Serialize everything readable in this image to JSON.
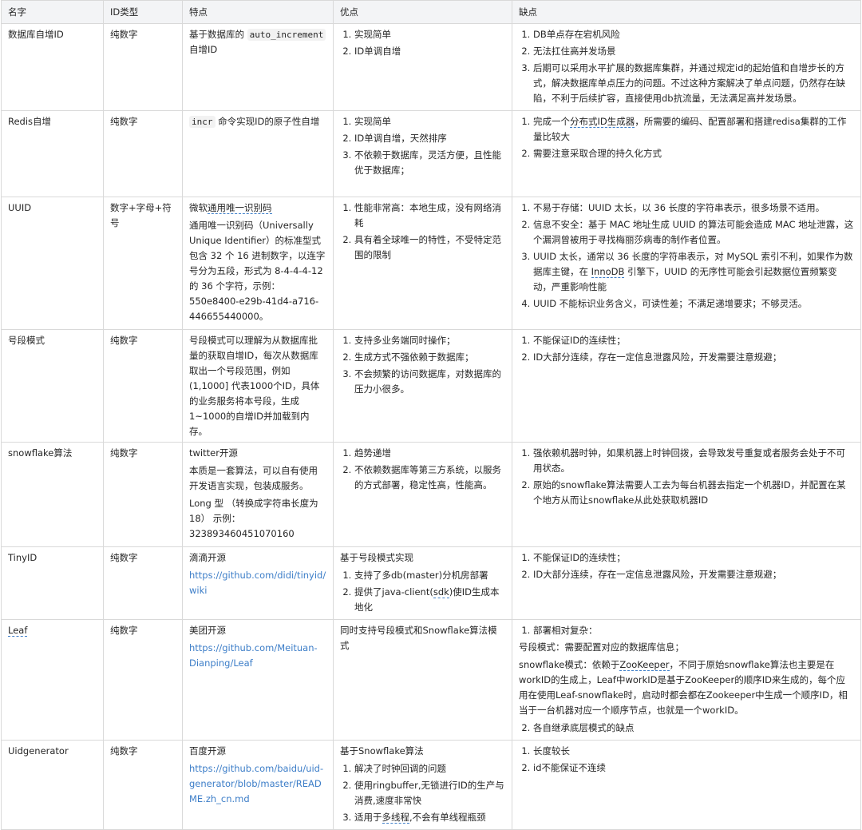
{
  "headers": [
    "名字",
    "ID类型",
    "特点",
    "优点",
    "缺点"
  ],
  "rows": [
    {
      "name": "数据库自增ID",
      "type": "纯数字",
      "features": {
        "prefix": "基于数据库的 ",
        "code": "auto_increment",
        "suffix": " 自增ID"
      },
      "pros": [
        "实现简单",
        "ID单调自增"
      ],
      "cons": [
        "DB单点存在宕机风险",
        "无法扛住高并发场景",
        "后期可以采用水平扩展的数据库集群，并通过规定id的起始值和自增步长的方式，解决数据库单点压力的问题。不过这种方案解决了单点问题，仍然存在缺陷，不利于后续扩容，直接使用db抗流量，无法满足高并发场景。"
      ]
    },
    {
      "name": "Redis自增",
      "type": "纯数字",
      "features": {
        "code": "incr",
        "suffix": " 命令实现ID的原子性自增"
      },
      "pros": [
        "实现简单",
        "ID单调自增，天然排序",
        "不依赖于数据库，灵活方便，且性能优于数据库；"
      ],
      "cons_first": {
        "pre": "完成一个",
        "link": "分布式ID生成器",
        "post": "，所需要的编码、配置部署和搭建redisa集群的工作量比较大"
      },
      "cons_rest": [
        "需要注意采取合理的持久化方式"
      ]
    },
    {
      "name": "UUID",
      "type": "数字+字母+符号",
      "features": {
        "pre": "微软",
        "link": "通用唯一识别码",
        "detail": "通用唯一识别码（Universally Unique Identifier）的标准型式包含 32 个 16 进制数字，以连字号分为五段，形式为 8-4-4-4-12 的 36 个字符，示例：550e8400-e29b-41d4-a716-446655440000。"
      },
      "pros": [
        "性能非常高：本地生成，没有网络消耗",
        "具有着全球唯一的特性，不受特定范围的限制"
      ],
      "cons": [
        "不易于存储：UUID 太长，以 36 长度的字符串表示，很多场景不适用。",
        "信息不安全：基于 MAC 地址生成 UUID 的算法可能会造成 MAC 地址泄露，这个漏洞曾被用于寻找梅丽莎病毒的制作者位置。"
      ],
      "cons_third": {
        "pre": "UUID 太长，通常以 36 长度的字符串表示，对 MySQL 索引不利，如果作为数据库主键，在 ",
        "link": "InnoDB",
        "post": " 引擎下，UUID 的无序性可能会引起数据位置频繁变动，严重影响性能"
      },
      "cons_fourth": "UUID 不能标识业务含义，可读性差；不满足递增要求；不够灵活。"
    },
    {
      "name": "号段模式",
      "type": "纯数字",
      "features": "号段模式可以理解为从数据库批量的获取自增ID，每次从数据库取出一个号段范围，例如 (1,1000] 代表1000个ID，具体的业务服务将本号段，生成1~1000的自增ID并加载到内存。",
      "pros": [
        "支持多业务端同时操作；",
        "生成方式不强依赖于数据库；",
        "不会频繁的访问数据库，对数据库的压力小很多。"
      ],
      "cons": [
        "不能保证ID的连续性；",
        "ID大部分连续，存在一定信息泄露风险，开发需要注意规避；"
      ]
    },
    {
      "name": "snowflake算法",
      "type": "纯数字",
      "features": [
        "twitter开源",
        "本质是一套算法，可以自有使用开发语言实现，包装成服务。",
        "Long 型 （转换成字符串长度为 18） 示例：323893460451070160"
      ],
      "pros": [
        "趋势递增",
        "不依赖数据库等第三方系统，以服务的方式部署，稳定性高，性能高。"
      ],
      "cons": [
        "强依赖机器时钟，如果机器上时钟回拨，会导致发号重复或者服务会处于不可用状态。",
        "原始的snowflake算法需要人工去为每台机器去指定一个机器ID，并配置在某个地方从而让snowflake从此处获取机器ID"
      ]
    },
    {
      "name": "TinyID",
      "type": "纯数字",
      "features": {
        "text": "滴滴开源",
        "url": "https://github.com/didi/tinyid/wiki"
      },
      "pros_intro": "基于号段模式实现",
      "pros_first": "支持了多db(master)分机房部署",
      "pros_second": {
        "pre": "提供了java-client(",
        "link": "sdk",
        "post": ")使ID生成本地化"
      },
      "cons": [
        "不能保证ID的连续性；",
        "ID大部分连续，存在一定信息泄露风险，开发需要注意规避；"
      ]
    },
    {
      "name": "Leaf",
      "type": "纯数字",
      "features": {
        "text": "美团开源",
        "url": "https://github.com/Meituan-Dianping/Leaf"
      },
      "pros_intro": "同时支持号段模式和Snowflake算法模式",
      "cons_first": "部署相对复杂：",
      "cons_segment": "号段模式：需要配置对应的数据库信息；",
      "cons_snow": {
        "pre": "snowflake模式：依赖于",
        "link": "ZooKeeper",
        "post": "，不同于原始snowflake算法也主要是在workID的生成上，Leaf中workID是基于ZooKeeper的顺序ID来生成的，每个应用在使用Leaf-snowflake时，启动时都会都在Zookeeper中生成一个顺序ID，相当于一台机器对应一个顺序节点，也就是一个workID。"
      },
      "cons_last": "各自继承底层模式的缺点"
    },
    {
      "name": "Uidgenerator",
      "type": "纯数字",
      "features": {
        "text": "百度开源",
        "url": "https://github.com/baidu/uid-generator/blob/master/README.zh_cn.md"
      },
      "pros_intro": "基于Snowflake算法",
      "pros": [
        "解决了时钟回调的问题",
        "使用ringbuffer,无锁进行ID的生产与消费,速度非常快"
      ],
      "pros_third": {
        "pre": "适用于",
        "link": "多线程",
        "post": ",不会有单线程瓶颈"
      },
      "cons": [
        "长度较长",
        "id不能保证不连续"
      ]
    }
  ]
}
